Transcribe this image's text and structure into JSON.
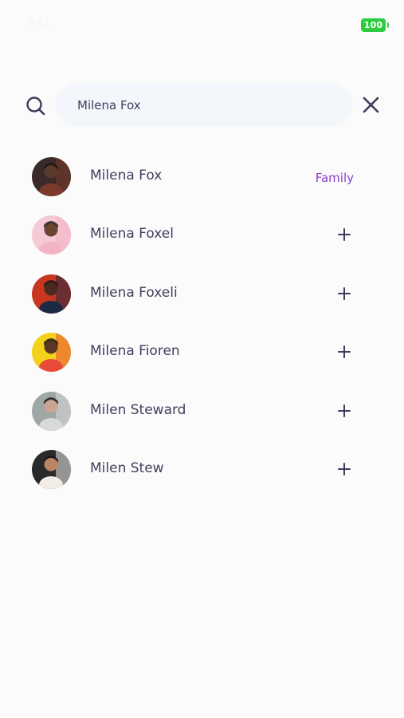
{
  "status_bar": {
    "time": "9:41",
    "battery": "100",
    "battery_color": "#2ecc40"
  },
  "search": {
    "value": "Milena Fox",
    "placeholder": "Search"
  },
  "results": [
    {
      "name": "Milena Fox",
      "action": "tag",
      "tag": "Family",
      "avatar_bg": "#3a2a2a",
      "avatar_accent": "#7b3a2a",
      "skin": "#5a3a2c"
    },
    {
      "name": "Milena Foxel",
      "action": "add",
      "tag": "",
      "avatar_bg": "#f6c9d6",
      "avatar_accent": "#f3b3c4",
      "skin": "#6b4532"
    },
    {
      "name": "Milena Foxeli",
      "action": "add",
      "tag": "",
      "avatar_bg": "#c9361f",
      "avatar_accent": "#1d2a44",
      "skin": "#4a2a1e"
    },
    {
      "name": "Milena Fioren",
      "action": "add",
      "tag": "",
      "avatar_bg": "#f4d21c",
      "avatar_accent": "#e84a3a",
      "skin": "#5a3624"
    },
    {
      "name": "Milen Steward",
      "action": "add",
      "tag": "",
      "avatar_bg": "#9ea7a3",
      "avatar_accent": "#d9d9d9",
      "skin": "#caa591"
    },
    {
      "name": "Milen Stew",
      "action": "add",
      "tag": "",
      "avatar_bg": "#2a2a2a",
      "avatar_accent": "#f1ede6",
      "skin": "#b98563"
    }
  ],
  "colors": {
    "accent": "#8a3fc9",
    "text": "#423f5e",
    "search_bg": "#f3f7fc"
  }
}
